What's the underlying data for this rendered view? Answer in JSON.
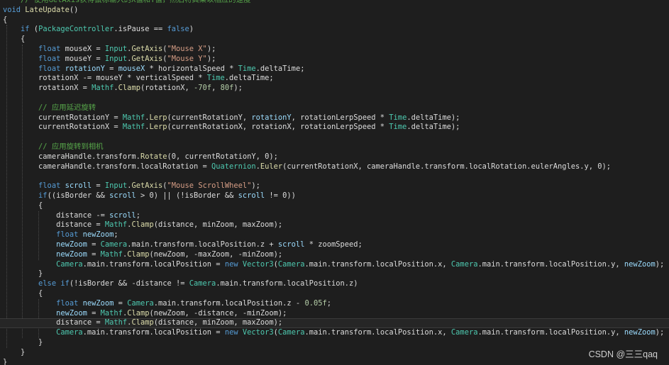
{
  "colors": {
    "background": "#1e1e1e",
    "keyword": "#569cd6",
    "class": "#4ec9b0",
    "method": "#dcdcaa",
    "string": "#d69d85",
    "number": "#b5cea8",
    "comment": "#57a64a",
    "field": "#9cdcfe",
    "plain": "#dcdcdc"
  },
  "code_lines": [
    {
      "tokens": [
        {
          "t": "    ",
          "k": "p"
        },
        {
          "t": "// 使用GetAxis获得鼠标输入的X值和Y值，然后将其乘以相应的速度",
          "k": "c"
        }
      ]
    },
    {
      "tokens": [
        {
          "t": "void",
          "k": "kw"
        },
        {
          "t": " ",
          "k": "p"
        },
        {
          "t": "LateUpdate",
          "k": "m"
        },
        {
          "t": "()",
          "k": "p"
        }
      ]
    },
    {
      "tokens": [
        {
          "t": "{",
          "k": "p"
        }
      ]
    },
    {
      "tokens": [
        {
          "t": "    ",
          "k": "p"
        },
        {
          "t": "if",
          "k": "kw"
        },
        {
          "t": " (",
          "k": "p"
        },
        {
          "t": "PackageController",
          "k": "cl"
        },
        {
          "t": ".isPause == ",
          "k": "p"
        },
        {
          "t": "false",
          "k": "kw"
        },
        {
          "t": ")",
          "k": "p"
        }
      ]
    },
    {
      "tokens": [
        {
          "t": "    {",
          "k": "p"
        }
      ]
    },
    {
      "tokens": [
        {
          "t": "        ",
          "k": "p"
        },
        {
          "t": "float",
          "k": "kw"
        },
        {
          "t": " mouseX = ",
          "k": "p"
        },
        {
          "t": "Input",
          "k": "cl"
        },
        {
          "t": ".",
          "k": "p"
        },
        {
          "t": "GetAxis",
          "k": "m"
        },
        {
          "t": "(",
          "k": "p"
        },
        {
          "t": "\"Mouse X\"",
          "k": "s"
        },
        {
          "t": ");",
          "k": "p"
        }
      ]
    },
    {
      "tokens": [
        {
          "t": "        ",
          "k": "p"
        },
        {
          "t": "float",
          "k": "kw"
        },
        {
          "t": " mouseY = ",
          "k": "p"
        },
        {
          "t": "Input",
          "k": "cl"
        },
        {
          "t": ".",
          "k": "p"
        },
        {
          "t": "GetAxis",
          "k": "m"
        },
        {
          "t": "(",
          "k": "p"
        },
        {
          "t": "\"Mouse Y\"",
          "k": "s"
        },
        {
          "t": ");",
          "k": "p"
        }
      ]
    },
    {
      "tokens": [
        {
          "t": "        ",
          "k": "p"
        },
        {
          "t": "float",
          "k": "kw"
        },
        {
          "t": " ",
          "k": "p"
        },
        {
          "t": "rotationY",
          "k": "f"
        },
        {
          "t": " = ",
          "k": "p"
        },
        {
          "t": "mouseX",
          "k": "f"
        },
        {
          "t": " * horizontalSpeed * ",
          "k": "p"
        },
        {
          "t": "Time",
          "k": "cl"
        },
        {
          "t": ".deltaTime;",
          "k": "p"
        }
      ]
    },
    {
      "tokens": [
        {
          "t": "        rotationX -= mouseY * verticalSpeed * ",
          "k": "p"
        },
        {
          "t": "Time",
          "k": "cl"
        },
        {
          "t": ".deltaTime;",
          "k": "p"
        }
      ]
    },
    {
      "tokens": [
        {
          "t": "        rotationX = ",
          "k": "p"
        },
        {
          "t": "Mathf",
          "k": "cl"
        },
        {
          "t": ".",
          "k": "p"
        },
        {
          "t": "Clamp",
          "k": "m"
        },
        {
          "t": "(rotationX, ",
          "k": "p"
        },
        {
          "t": "-70f",
          "k": "n"
        },
        {
          "t": ", ",
          "k": "p"
        },
        {
          "t": "80f",
          "k": "n"
        },
        {
          "t": ");",
          "k": "p"
        }
      ]
    },
    {
      "tokens": [
        {
          "t": "",
          "k": "p"
        }
      ]
    },
    {
      "tokens": [
        {
          "t": "        ",
          "k": "p"
        },
        {
          "t": "// 应用延迟旋转",
          "k": "c"
        }
      ]
    },
    {
      "tokens": [
        {
          "t": "        currentRotationY = ",
          "k": "p"
        },
        {
          "t": "Mathf",
          "k": "cl"
        },
        {
          "t": ".",
          "k": "p"
        },
        {
          "t": "Lerp",
          "k": "m"
        },
        {
          "t": "(currentRotationY, ",
          "k": "p"
        },
        {
          "t": "rotationY",
          "k": "f"
        },
        {
          "t": ", rotationLerpSpeed * ",
          "k": "p"
        },
        {
          "t": "Time",
          "k": "cl"
        },
        {
          "t": ".deltaTime);",
          "k": "p"
        }
      ]
    },
    {
      "tokens": [
        {
          "t": "        currentRotationX = ",
          "k": "p"
        },
        {
          "t": "Mathf",
          "k": "cl"
        },
        {
          "t": ".",
          "k": "p"
        },
        {
          "t": "Lerp",
          "k": "m"
        },
        {
          "t": "(currentRotationX, rotationX, rotationLerpSpeed * ",
          "k": "p"
        },
        {
          "t": "Time",
          "k": "cl"
        },
        {
          "t": ".deltaTime);",
          "k": "p"
        }
      ]
    },
    {
      "tokens": [
        {
          "t": "",
          "k": "p"
        }
      ]
    },
    {
      "tokens": [
        {
          "t": "        ",
          "k": "p"
        },
        {
          "t": "// 应用旋转到相机",
          "k": "c"
        }
      ]
    },
    {
      "tokens": [
        {
          "t": "        cameraHandle.transform.",
          "k": "p"
        },
        {
          "t": "Rotate",
          "k": "m"
        },
        {
          "t": "(0, currentRotationY, 0);",
          "k": "p"
        }
      ]
    },
    {
      "tokens": [
        {
          "t": "        cameraHandle.transform.localRotation = ",
          "k": "p"
        },
        {
          "t": "Quaternion",
          "k": "cl"
        },
        {
          "t": ".",
          "k": "p"
        },
        {
          "t": "Euler",
          "k": "m"
        },
        {
          "t": "(currentRotationX, cameraHandle.transform.localRotation.eulerAngles.y, 0);",
          "k": "p"
        }
      ]
    },
    {
      "tokens": [
        {
          "t": "",
          "k": "p"
        }
      ]
    },
    {
      "tokens": [
        {
          "t": "        ",
          "k": "p"
        },
        {
          "t": "float",
          "k": "kw"
        },
        {
          "t": " ",
          "k": "p"
        },
        {
          "t": "scroll",
          "k": "f"
        },
        {
          "t": " = ",
          "k": "p"
        },
        {
          "t": "Input",
          "k": "cl"
        },
        {
          "t": ".",
          "k": "p"
        },
        {
          "t": "GetAxis",
          "k": "m"
        },
        {
          "t": "(",
          "k": "p"
        },
        {
          "t": "\"Mouse ScrollWheel\"",
          "k": "s"
        },
        {
          "t": ");",
          "k": "p"
        }
      ]
    },
    {
      "tokens": [
        {
          "t": "        ",
          "k": "p"
        },
        {
          "t": "if",
          "k": "kw"
        },
        {
          "t": "((isBorder && ",
          "k": "p"
        },
        {
          "t": "scroll",
          "k": "f"
        },
        {
          "t": " > 0) || (!isBorder && ",
          "k": "p"
        },
        {
          "t": "scroll",
          "k": "f"
        },
        {
          "t": " != 0))",
          "k": "p"
        }
      ]
    },
    {
      "tokens": [
        {
          "t": "        {",
          "k": "p"
        }
      ]
    },
    {
      "tokens": [
        {
          "t": "            distance -= ",
          "k": "p"
        },
        {
          "t": "scroll",
          "k": "f"
        },
        {
          "t": ";",
          "k": "p"
        }
      ]
    },
    {
      "tokens": [
        {
          "t": "            distance = ",
          "k": "p"
        },
        {
          "t": "Mathf",
          "k": "cl"
        },
        {
          "t": ".",
          "k": "p"
        },
        {
          "t": "Clamp",
          "k": "m"
        },
        {
          "t": "(distance, minZoom, maxZoom);",
          "k": "p"
        }
      ]
    },
    {
      "tokens": [
        {
          "t": "            ",
          "k": "p"
        },
        {
          "t": "float",
          "k": "kw"
        },
        {
          "t": " ",
          "k": "p"
        },
        {
          "t": "newZoom",
          "k": "f"
        },
        {
          "t": ";",
          "k": "p"
        }
      ]
    },
    {
      "tokens": [
        {
          "t": "            ",
          "k": "p"
        },
        {
          "t": "newZoom",
          "k": "f"
        },
        {
          "t": " = ",
          "k": "p"
        },
        {
          "t": "Camera",
          "k": "cl"
        },
        {
          "t": ".main.transform.localPosition.z + ",
          "k": "p"
        },
        {
          "t": "scroll",
          "k": "f"
        },
        {
          "t": " * zoomSpeed;",
          "k": "p"
        }
      ]
    },
    {
      "tokens": [
        {
          "t": "            ",
          "k": "p"
        },
        {
          "t": "newZoom",
          "k": "f"
        },
        {
          "t": " = ",
          "k": "p"
        },
        {
          "t": "Mathf",
          "k": "cl"
        },
        {
          "t": ".",
          "k": "p"
        },
        {
          "t": "Clamp",
          "k": "m"
        },
        {
          "t": "(newZoom, -maxZoom, -minZoom);",
          "k": "p"
        }
      ]
    },
    {
      "tokens": [
        {
          "t": "            ",
          "k": "p"
        },
        {
          "t": "Camera",
          "k": "cl"
        },
        {
          "t": ".main.transform.localPosition = ",
          "k": "p"
        },
        {
          "t": "new",
          "k": "kw"
        },
        {
          "t": " ",
          "k": "p"
        },
        {
          "t": "Vector3",
          "k": "cl"
        },
        {
          "t": "(",
          "k": "p"
        },
        {
          "t": "Camera",
          "k": "cl"
        },
        {
          "t": ".main.transform.localPosition.x, ",
          "k": "p"
        },
        {
          "t": "Camera",
          "k": "cl"
        },
        {
          "t": ".main.transform.localPosition.y, ",
          "k": "p"
        },
        {
          "t": "newZoom",
          "k": "f"
        },
        {
          "t": ");",
          "k": "p"
        }
      ]
    },
    {
      "tokens": [
        {
          "t": "        }",
          "k": "p"
        }
      ]
    },
    {
      "tokens": [
        {
          "t": "        ",
          "k": "p"
        },
        {
          "t": "else",
          "k": "kw"
        },
        {
          "t": " ",
          "k": "p"
        },
        {
          "t": "if",
          "k": "kw"
        },
        {
          "t": "(!isBorder && -distance != ",
          "k": "p"
        },
        {
          "t": "Camera",
          "k": "cl"
        },
        {
          "t": ".main.transform.localPosition.z)",
          "k": "p"
        }
      ]
    },
    {
      "tokens": [
        {
          "t": "        {",
          "k": "p"
        }
      ]
    },
    {
      "tokens": [
        {
          "t": "            ",
          "k": "p"
        },
        {
          "t": "float",
          "k": "kw"
        },
        {
          "t": " ",
          "k": "p"
        },
        {
          "t": "newZoom",
          "k": "f"
        },
        {
          "t": " = ",
          "k": "p"
        },
        {
          "t": "Camera",
          "k": "cl"
        },
        {
          "t": ".main.transform.localPosition.z - ",
          "k": "p"
        },
        {
          "t": "0.05f",
          "k": "n"
        },
        {
          "t": ";",
          "k": "p"
        }
      ]
    },
    {
      "tokens": [
        {
          "t": "            ",
          "k": "p"
        },
        {
          "t": "newZoom",
          "k": "f"
        },
        {
          "t": " = ",
          "k": "p"
        },
        {
          "t": "Mathf",
          "k": "cl"
        },
        {
          "t": ".",
          "k": "p"
        },
        {
          "t": "Clamp",
          "k": "m"
        },
        {
          "t": "(newZoom, -distance, -minZoom);",
          "k": "p"
        }
      ]
    },
    {
      "tokens": [
        {
          "t": "            distance = ",
          "k": "p"
        },
        {
          "t": "Mathf",
          "k": "cl"
        },
        {
          "t": ".",
          "k": "p"
        },
        {
          "t": "Clamp",
          "k": "m"
        },
        {
          "t": "(distance, minZoom, maxZoom);",
          "k": "p"
        }
      ]
    },
    {
      "tokens": [
        {
          "t": "            ",
          "k": "p"
        },
        {
          "t": "Camera",
          "k": "cl"
        },
        {
          "t": ".main.transform.localPosition = ",
          "k": "p"
        },
        {
          "t": "new",
          "k": "kw"
        },
        {
          "t": " ",
          "k": "p"
        },
        {
          "t": "Vector3",
          "k": "cl"
        },
        {
          "t": "(",
          "k": "p"
        },
        {
          "t": "Camera",
          "k": "cl"
        },
        {
          "t": ".main.transform.localPosition.x, ",
          "k": "p"
        },
        {
          "t": "Camera",
          "k": "cl"
        },
        {
          "t": ".main.transform.localPosition.y, ",
          "k": "p"
        },
        {
          "t": "newZoom",
          "k": "f"
        },
        {
          "t": ");",
          "k": "p"
        }
      ]
    },
    {
      "tokens": [
        {
          "t": "        }",
          "k": "p"
        }
      ]
    },
    {
      "tokens": [
        {
          "t": "    }",
          "k": "p"
        }
      ]
    },
    {
      "tokens": [
        {
          "t": "}",
          "k": "p"
        }
      ]
    }
  ],
  "highlighted_line": 33,
  "watermark": "CSDN @三三qaq"
}
